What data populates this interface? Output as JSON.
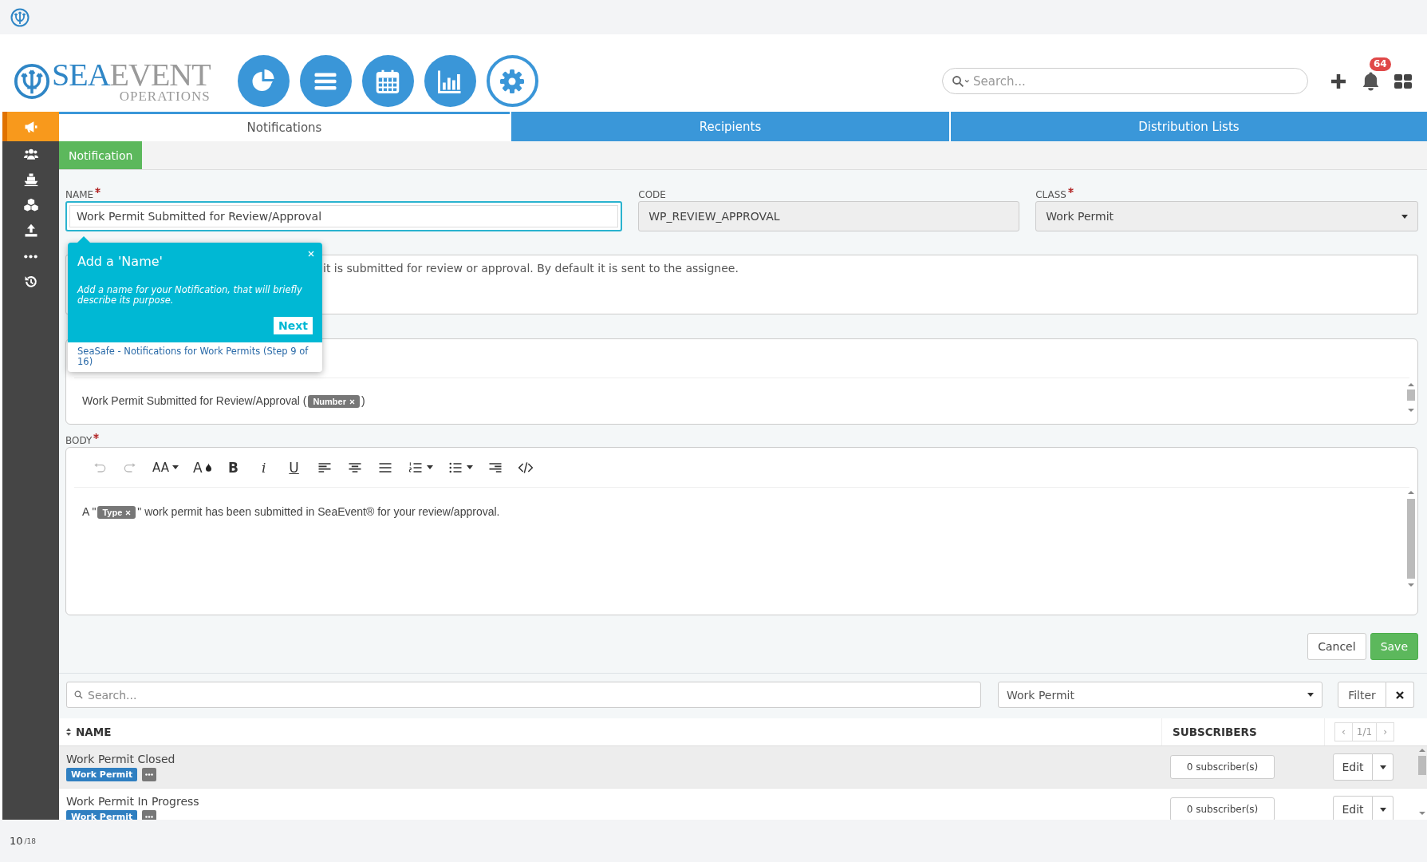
{
  "header": {
    "logo": {
      "brand_primary": "SEA",
      "brand_secondary": "EVENT",
      "tagline": "OPERATIONS"
    },
    "search": {
      "placeholder": "Search..."
    },
    "notification_count": "64"
  },
  "modules": [
    {
      "kind": "pie",
      "selected": false
    },
    {
      "kind": "list",
      "selected": false
    },
    {
      "kind": "calendar",
      "selected": false
    },
    {
      "kind": "bars",
      "selected": false
    },
    {
      "kind": "gear",
      "selected": true
    }
  ],
  "sidebar": {
    "items": [
      {
        "kind": "megaphone",
        "selected": true
      },
      {
        "kind": "users",
        "selected": false
      },
      {
        "kind": "ship",
        "selected": false
      },
      {
        "kind": "boxes",
        "selected": false
      },
      {
        "kind": "upload",
        "selected": false
      },
      {
        "kind": "more",
        "selected": false
      },
      {
        "kind": "history",
        "selected": false
      }
    ]
  },
  "tabs": [
    {
      "label": "Notifications",
      "selected": true
    },
    {
      "label": "Recipients",
      "selected": false
    },
    {
      "label": "Distribution Lists",
      "selected": false
    }
  ],
  "subtabs": [
    {
      "label": "Notification",
      "selected": true
    }
  ],
  "form": {
    "name": {
      "label": "NAME",
      "required": true,
      "value": "Work Permit Submitted for Review/Approval"
    },
    "code": {
      "label": "CODE",
      "disabled": true,
      "value": "WP_REVIEW_APPROVAL"
    },
    "class": {
      "label": "CLASS",
      "required": true,
      "value": "Work Permit"
    },
    "description": {
      "value": "it is submitted for review or approval. By default it is sent to the assignee."
    },
    "subject": {
      "text_before": "Work Permit Submitted for Review/Approval (",
      "token": "Number",
      "text_after": ")"
    },
    "body": {
      "label": "BODY",
      "required": true,
      "text_before": "A \"",
      "token": "Type",
      "text_after": "\" work permit has been submitted in SeaEvent® for your review/approval.",
      "toolbar": [
        {
          "kind": "undo",
          "disabled": true
        },
        {
          "kind": "redo",
          "disabled": true
        },
        {
          "kind": "font-size",
          "label": "AA",
          "dropdown": true,
          "disabled": false
        },
        {
          "kind": "text-color",
          "label": "A",
          "disabled": false
        },
        {
          "kind": "bold",
          "label": "B",
          "disabled": false
        },
        {
          "kind": "italic",
          "label": "i",
          "disabled": false
        },
        {
          "kind": "underline",
          "label": "U",
          "disabled": false
        },
        {
          "kind": "align-left",
          "disabled": false
        },
        {
          "kind": "align-center",
          "disabled": false
        },
        {
          "kind": "justify",
          "disabled": false
        },
        {
          "kind": "ordered-list",
          "dropdown": true,
          "disabled": false
        },
        {
          "kind": "bullet-list",
          "dropdown": true,
          "disabled": false
        },
        {
          "kind": "align-right",
          "disabled": false
        },
        {
          "kind": "code",
          "disabled": false
        }
      ]
    },
    "actions": [
      {
        "label": "Cancel",
        "kind": "default"
      },
      {
        "label": "Save",
        "kind": "primary"
      }
    ]
  },
  "tooltip": {
    "title": "Add a 'Name'",
    "text": "Add a name for your Notification, that will briefly describe its purpose.",
    "button": "Next",
    "footer": "SeaSafe - Notifications for Work Permits (Step 9 of 16)"
  },
  "list": {
    "search": {
      "placeholder": "Search..."
    },
    "filter_select": "Work Permit",
    "filter_button": "Filter",
    "columns": [
      "NAME",
      "SUBSCRIBERS"
    ],
    "pagination": {
      "prev": "‹",
      "page": "1/1",
      "next": "›"
    },
    "rows": [
      {
        "name": "Work Permit Closed",
        "tag": "Work Permit",
        "subscribers": "0 subscriber(s)",
        "action": "Edit",
        "selected": true
      },
      {
        "name": "Work Permit In Progress",
        "tag": "Work Permit",
        "subscribers": "0 subscriber(s)",
        "action": "Edit",
        "selected": false
      }
    ]
  },
  "pager": {
    "current": "10",
    "total": "/18"
  }
}
